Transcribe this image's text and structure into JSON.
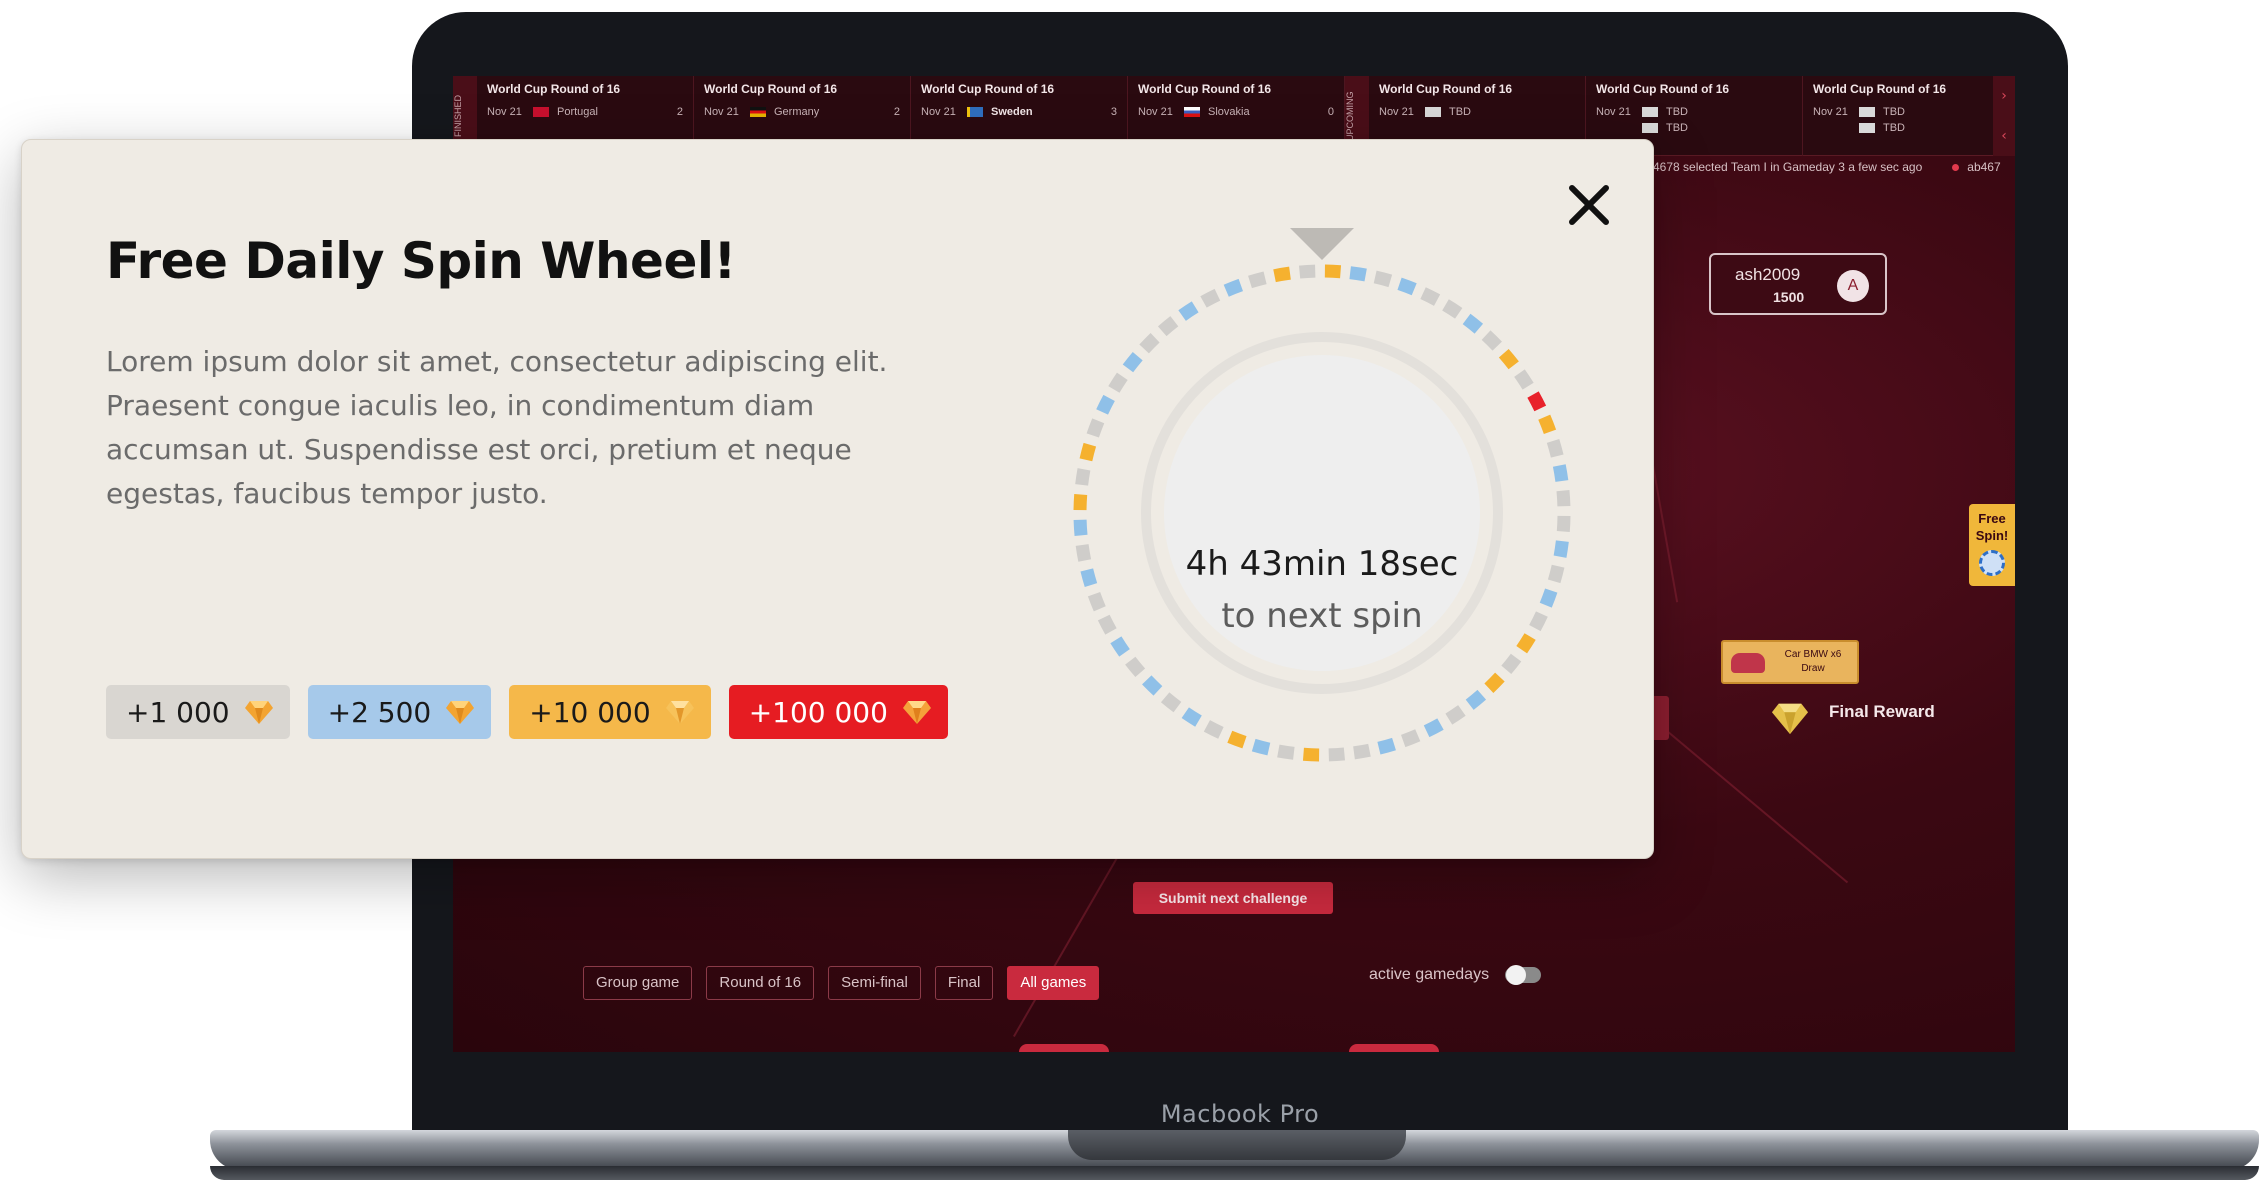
{
  "device": {
    "model_label": "Macbook Pro"
  },
  "scoreboard": {
    "left_side_label": "FINISHED",
    "right_side_label": "UPCOMING",
    "finished_matches": [
      {
        "stage": "World Cup Round of 16",
        "date": "Nov 21",
        "team": "Portugal",
        "score": "2",
        "flag": "#c8102e"
      },
      {
        "stage": "World Cup Round of 16",
        "date": "Nov 21",
        "team": "Germany",
        "score": "2",
        "flag": "#d4a017"
      },
      {
        "stage": "World Cup Round of 16",
        "date": "Nov 21",
        "team": "Sweden",
        "score": "3",
        "flag": "#2f6fbf"
      },
      {
        "stage": "World Cup Round of 16",
        "date": "Nov 21",
        "team": "Slovakia",
        "score": "0",
        "flag": "#3b5fc0"
      }
    ],
    "upcoming_matches": [
      {
        "stage": "World Cup Round of 16",
        "date": "Nov 21",
        "team": "TBD",
        "team2": ""
      },
      {
        "stage": "World Cup Round of 16",
        "date": "Nov 21",
        "team": "TBD",
        "team2": "TBD"
      },
      {
        "stage": "World Cup Round of 16",
        "date": "Nov 21",
        "team": "TBD",
        "team2": "TBD"
      }
    ],
    "ticker_text": "4678 selected Team I in Gameday 3 a few sec ago",
    "ticker_user": "ab467"
  },
  "board": {
    "user": {
      "name": "ash2009",
      "points": "1500",
      "avatar_letter": "A"
    },
    "free_spin_label_1": "Free",
    "free_spin_label_2": "Spin!",
    "car_reward_line1": "Car BMW x6",
    "car_reward_line2": "Draw",
    "final_reward_label": "Final Reward",
    "submit_label": "Submit next challenge",
    "filters": [
      {
        "label": "Group game",
        "active": false
      },
      {
        "label": "Round of 16",
        "active": false
      },
      {
        "label": "Semi-final",
        "active": false
      },
      {
        "label": "Final",
        "active": false
      },
      {
        "label": "All games",
        "active": true
      }
    ],
    "gamedays_label": "active gamedays"
  },
  "modal": {
    "title": "Free Daily Spin Wheel!",
    "description": "Lorem ipsum dolor sit amet, consectetur adipiscing elit. Praesent congue iaculis leo, in condimentum diam accumsan ut. Suspendisse est orci, pretium et neque egestas, faucibus tempor justo.",
    "close_icon": "close-icon",
    "timer": "4h 43min 18sec",
    "timer_sub": "to next spin",
    "rewards": [
      {
        "label": "+1 000",
        "tier": "grey"
      },
      {
        "label": "+2 500",
        "tier": "blue"
      },
      {
        "label": "+10 000",
        "tier": "yellow"
      },
      {
        "label": "+100 000",
        "tier": "red"
      }
    ]
  },
  "colors": {
    "wheel_blue": "#8fc0e8",
    "wheel_grey": "#cfcdca",
    "wheel_yellow": "#f5b12f",
    "wheel_red": "#e8212a",
    "accent_red": "#c92a3e",
    "board_bg": "#3a0812"
  }
}
